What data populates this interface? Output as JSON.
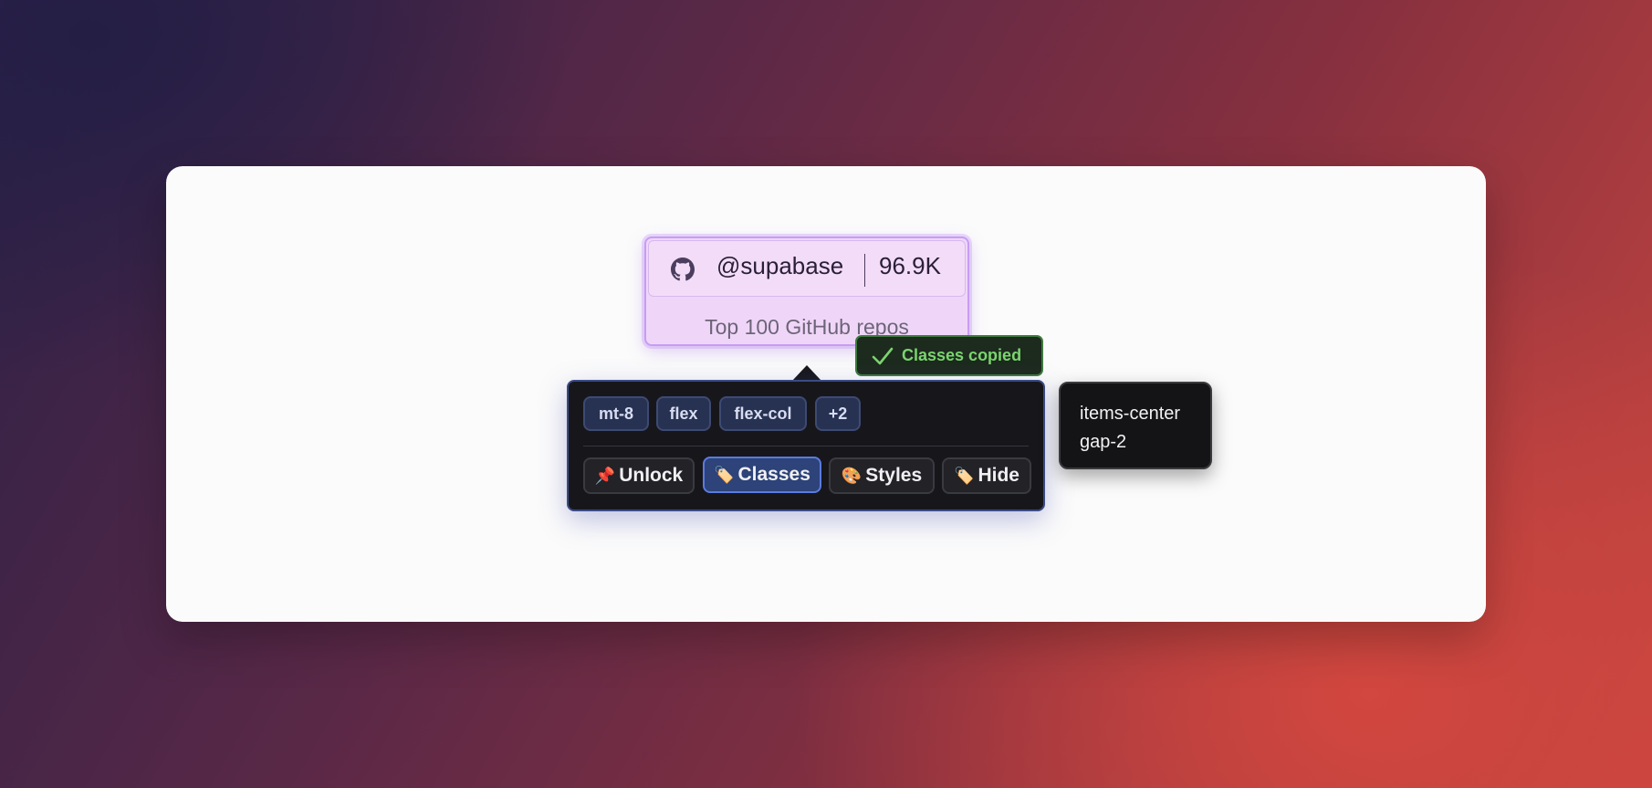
{
  "badge": {
    "icon": "github-icon",
    "handle": "@supabase",
    "count": "96.9K",
    "subtitle": "Top 100 GitHub repos"
  },
  "toast": {
    "icon": "check-icon",
    "text": "Classes copied",
    "color": "#7ad56e"
  },
  "inspector": {
    "classes": [
      "mt-8",
      "flex",
      "flex-col",
      "+2"
    ],
    "actions": [
      {
        "emoji": "📌",
        "label": "Unlock"
      },
      {
        "emoji": "🏷️",
        "label": "Classes",
        "active": true
      },
      {
        "emoji": "🎨",
        "label": "Styles"
      },
      {
        "emoji": "🏷️",
        "label": "Hide"
      }
    ]
  },
  "tooltip": {
    "lines": [
      "items-center",
      "gap-2"
    ]
  },
  "colors": {
    "accent": "#5b7be0",
    "badge_bg": "#efd6f8",
    "panel_bg": "#17171b"
  }
}
